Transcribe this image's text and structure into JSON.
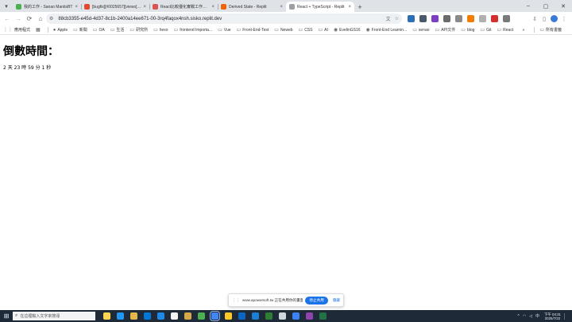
{
  "browser": {
    "tabs": [
      {
        "label": "我的工作 - Sanao MantisBT",
        "favicon_color": "#4caf50",
        "active": false
      },
      {
        "label": "[bugfix][#0025657][views] Sc",
        "favicon_color": "#e2492f",
        "active": false
      },
      {
        "label": "React比較優化實戰工作的畫面",
        "favicon_color": "#d9534f",
        "active": false
      },
      {
        "label": "Derived State - Replit",
        "favicon_color": "#f26207",
        "active": false
      },
      {
        "label": "React + TypeScript - Replit",
        "favicon_color": "#9aa0a6",
        "active": true
      }
    ],
    "new_tab_label": "+",
    "window_controls": {
      "minimize": "–",
      "maximize": "▢",
      "close": "✕"
    },
    "address_bar": {
      "url": "88cb3355-e45d-4d37-8c1b-2400a14ee671-00-3rq4faqox4nsh.sisko.replit.dev"
    },
    "nav": {
      "back": "←",
      "forward": "→",
      "reload": "⟳",
      "home": "⌂"
    },
    "extension_colors": [
      "#2d6fb7",
      "#4a5a6a",
      "#7b3fc4",
      "#6b6b6b",
      "#8a8a8a",
      "#f57c00",
      "#b0b0b0",
      "#d32f2f",
      "#7a7a7a"
    ],
    "bookmarks": [
      {
        "label": "應用程式",
        "icon": "grid-icon"
      },
      {
        "label": "",
        "icon": "apps-icon"
      },
      {
        "label": "Apple",
        "icon": "apple-icon"
      },
      {
        "label": "新聞",
        "icon": "folder-icon"
      },
      {
        "label": "OA",
        "icon": "folder-icon"
      },
      {
        "label": "生活",
        "icon": "folder-icon"
      },
      {
        "label": "研究所",
        "icon": "folder-icon"
      },
      {
        "label": "hexo",
        "icon": "folder-icon"
      },
      {
        "label": "frontend Importa...",
        "icon": "folder-icon"
      },
      {
        "label": "Vue",
        "icon": "folder-icon"
      },
      {
        "label": "Front-End-Test",
        "icon": "folder-icon"
      },
      {
        "label": "Neweb",
        "icon": "folder-icon"
      },
      {
        "label": "CSS",
        "icon": "folder-icon"
      },
      {
        "label": "AI",
        "icon": "folder-icon"
      },
      {
        "label": "EvelinGS16",
        "icon": "github-icon"
      },
      {
        "label": "Front-End Learnin...",
        "icon": "github-icon"
      },
      {
        "label": "senao",
        "icon": "folder-icon"
      },
      {
        "label": "API文件",
        "icon": "folder-icon"
      },
      {
        "label": "blog",
        "icon": "folder-icon"
      },
      {
        "label": "Git",
        "icon": "folder-icon"
      },
      {
        "label": "React",
        "icon": "folder-icon"
      }
    ],
    "bookmarks_overflow": "»",
    "all_bookmarks": "所有書籤"
  },
  "page": {
    "heading": "倒數時間：",
    "countdown": "2 天 23 時 59 分 1 秒"
  },
  "share_banner": {
    "text": "www.apowersoft.tw 正在共用你的畫面。",
    "stop_label": "停止共用",
    "hide_label": "隱藏"
  },
  "taskbar": {
    "search_placeholder": "在這裡輸入文字來搜尋",
    "app_colors": [
      "#ffd54f",
      "#2196f3",
      "#e5b74a",
      "#0078d7",
      "#1e88e5",
      "#f4f4f4",
      "#d4a94a",
      "#4caf50",
      "#4285f4",
      "#ffca28",
      "#0b66c2",
      "#1b7fd6",
      "#2e7d32",
      "#cfd8dc",
      "#3b82f6",
      "#8e44ad",
      "#217346"
    ],
    "time": "下午 04:31",
    "date": "2025/7/22"
  }
}
